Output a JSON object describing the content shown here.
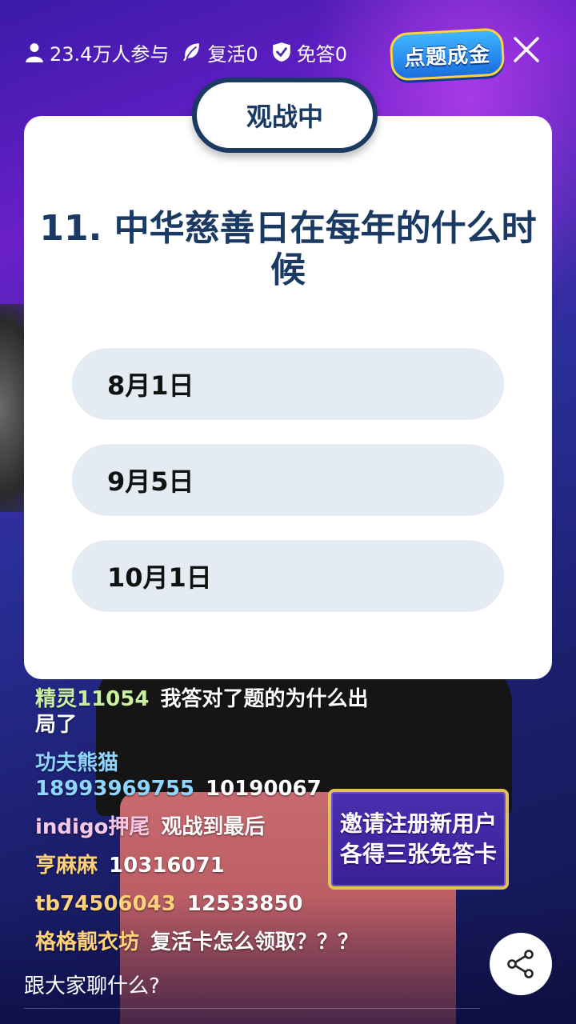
{
  "header": {
    "participants": "23.4万人参与",
    "revive": "复活0",
    "exempt": "免答0",
    "logo_text": "点题成金",
    "icons": {
      "participants": "person-icon",
      "revive": "leaf-icon",
      "exempt": "shield-check-icon",
      "close": "close-icon"
    }
  },
  "quiz": {
    "status": "观战中",
    "question": "11. 中华慈善日在每年的什么时候",
    "options": [
      {
        "label": "8月1日"
      },
      {
        "label": "9月5日"
      },
      {
        "label": "10月1日"
      }
    ]
  },
  "chat": {
    "messages": [
      {
        "user": "精灵11054",
        "text": "我答对了题的为什么出局了",
        "user_color": "#c8f0a0"
      },
      {
        "user": "功夫熊猫18993969755",
        "text": "10190067",
        "user_color": "#8fd6ff"
      },
      {
        "user": "indigo押尾",
        "text": "观战到最后",
        "user_color": "#f7c8e4"
      },
      {
        "user": "亨麻麻",
        "text": "10316071",
        "user_color": "#ffd27a"
      },
      {
        "user": "tb74506043",
        "text": "12533850",
        "user_color": "#ffd27a"
      },
      {
        "user": "格格靓衣坊",
        "text": "复活卡怎么领取？？？",
        "user_color": "#ffd27a"
      }
    ]
  },
  "invite": {
    "line1": "邀请注册新用户",
    "line2": "各得三张免答卡"
  },
  "footer": {
    "chat_placeholder": "跟大家聊什么?",
    "share_icon": "share-icon"
  },
  "colors": {
    "card_text": "#1a3a63",
    "option_bg": "#e4ebf3",
    "logo_border": "#ffd23f"
  }
}
